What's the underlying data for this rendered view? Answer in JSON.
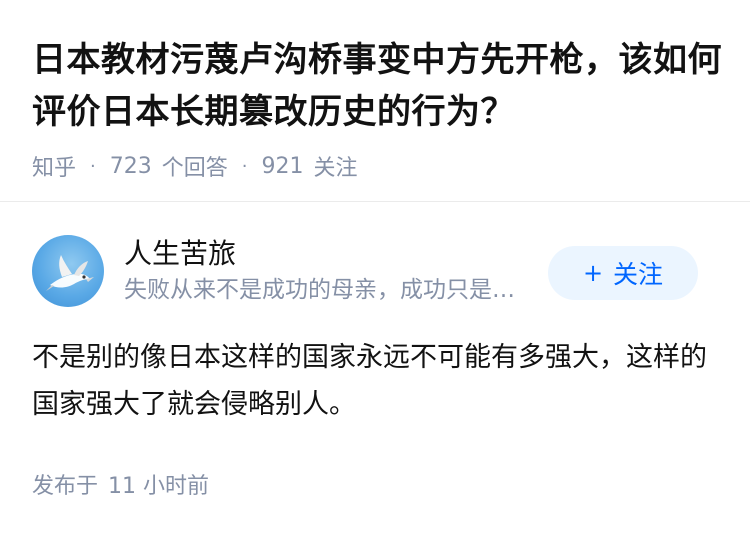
{
  "question": {
    "title": "日本教材污蔑卢沟桥事变中方先开枪，该如何评价日本长期篡改历史的行为？",
    "source": "知乎",
    "answer_count": "723",
    "answer_label": "个回答",
    "follower_count": "921",
    "follower_label": "关注"
  },
  "answer": {
    "author": {
      "name": "人生苦旅",
      "bio": "失败从来不是成功的母亲，成功只是成功的父亲",
      "avatar_icon": "bird-avatar"
    },
    "follow_button": {
      "icon": "plus-icon",
      "label": "关注"
    },
    "content": "不是别的像日本这样的国家永远不可能有多强大，这样的国家强大了就会侵略别人。",
    "published_prefix": "发布于",
    "published_time": "11 小时前"
  },
  "colors": {
    "primary": "#0066ff",
    "follow_bg": "#ebf5ff",
    "meta_text": "#8590a6",
    "body_text": "#121212"
  }
}
